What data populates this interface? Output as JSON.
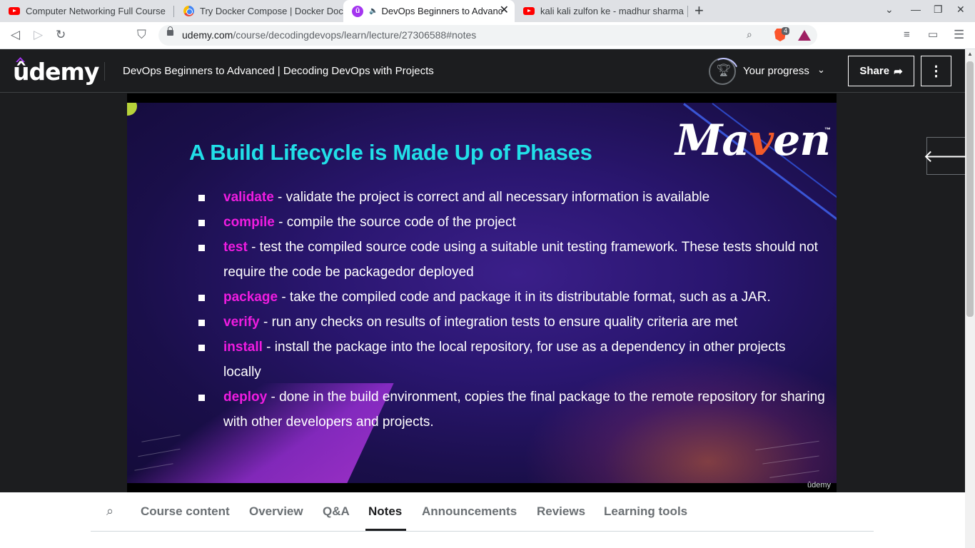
{
  "browser": {
    "tabs": [
      {
        "title": "Computer Networking Full Course",
        "icon": "youtube-icon",
        "active": false
      },
      {
        "title": "Try Docker Compose | Docker Docs",
        "icon": "chrome-icon",
        "active": false
      },
      {
        "title": "DevOps Beginners to Advanced",
        "icon": "udemy-icon",
        "active": true,
        "audio": "🔈"
      },
      {
        "title": "kali kali zulfon ke - madhur sharma",
        "icon": "youtube-icon",
        "active": false
      }
    ],
    "new_tab": "+",
    "url_host": "udemy.com",
    "url_path": "/course/decodingdevops/learn/lecture/27306588#notes",
    "brave_shield_count": "4"
  },
  "header": {
    "logo": "ûdemy",
    "course_title": "DevOps Beginners to Advanced | Decoding DevOps with Projects",
    "progress_label": "Your progress",
    "share_label": "Share",
    "more_label": "⋮"
  },
  "slide": {
    "title": "A Build Lifecycle is Made Up of Phases",
    "logo_text": "Maven",
    "logo_tm": "™",
    "phases": [
      {
        "keyword": "validate",
        "text": " - validate the project is correct and all necessary information is available"
      },
      {
        "keyword": "compile",
        "text": " - compile the source code of the project"
      },
      {
        "keyword": "test",
        "text": " - test the compiled source code using a suitable unit testing framework. These tests should not require the code be packagedor deployed"
      },
      {
        "keyword": "package",
        "text": " - take the compiled code and package it in its distributable format, such as a JAR."
      },
      {
        "keyword": "verify",
        "text": " - run any checks on results of integration tests to ensure quality criteria are met"
      },
      {
        "keyword": "install",
        "text": " - install the package into the local repository, for use as a dependency in other projects locally"
      },
      {
        "keyword": "deploy",
        "text": " - done in the build environment, copies the final package to the remote repository for sharing with other developers and projects."
      }
    ],
    "watermark": "ûdemy"
  },
  "bottom_tabs": {
    "items": [
      "Course content",
      "Overview",
      "Q&A",
      "Notes",
      "Announcements",
      "Reviews",
      "Learning tools"
    ],
    "active": "Notes"
  },
  "colors": {
    "udemy_purple": "#a435f0",
    "slide_title": "#21dfe8",
    "slide_keyword": "#ef1ce0",
    "header_bg": "#1c1d1f"
  }
}
